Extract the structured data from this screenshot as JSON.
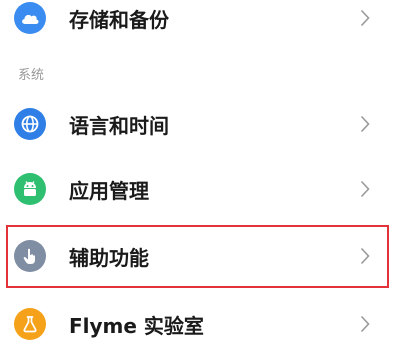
{
  "rows": [
    {
      "label": "存储和备份",
      "icon": "cloud-icon",
      "color": "#3b8cf0"
    },
    {
      "label": "语言和时间",
      "icon": "globe-icon",
      "color": "#2f7fe6"
    },
    {
      "label": "应用管理",
      "icon": "android-icon",
      "color": "#2fbf71"
    },
    {
      "label": "辅助功能",
      "icon": "hand-icon",
      "color": "#7f8ea3"
    },
    {
      "label": "Flyme 实验室",
      "icon": "flask-icon",
      "color": "#f5a21a"
    }
  ],
  "section_header": "系统",
  "highlight_color": "#e2333a"
}
